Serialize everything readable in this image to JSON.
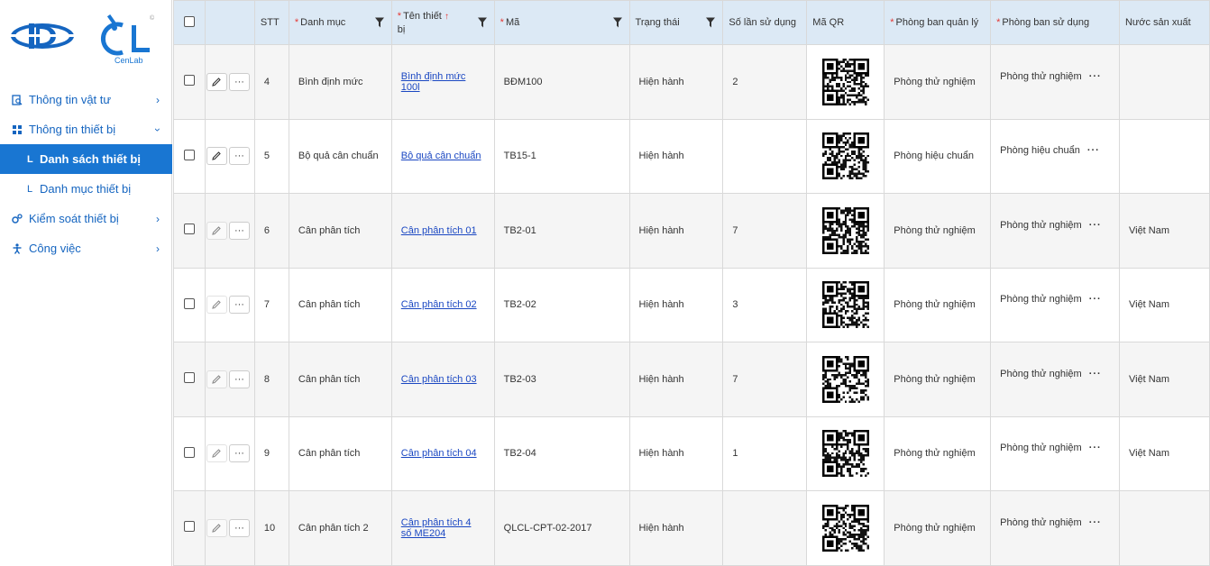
{
  "sidebar": {
    "brand_text": "CenLab",
    "brand_mark": "©",
    "items": [
      {
        "label": "Thông tin vật tư",
        "icon": "document-search-icon"
      },
      {
        "label": "Thông tin thiết bị",
        "icon": "grid-icon"
      },
      {
        "label": "Danh sách thiết bị",
        "prefix": "L",
        "active": true
      },
      {
        "label": "Danh mục thiết bị",
        "prefix": "L"
      },
      {
        "label": "Kiểm soát thiết bị",
        "icon": "gears-icon"
      },
      {
        "label": "Công việc",
        "icon": "person-icon"
      }
    ]
  },
  "table": {
    "headers": {
      "stt": "STT",
      "danh_muc": "Danh mục",
      "ten_thiet_bi_1": "Tên thiết",
      "ten_thiet_bi_2": "bị",
      "ma": "Mã",
      "trang_thai": "Trạng thái",
      "so_lan_su_dung": "Số lần sử dụng",
      "ma_qr": "Mã QR",
      "phong_ban_quan_ly": "Phòng ban quản lý",
      "phong_ban_su_dung": "Phòng ban sử dụng",
      "nuoc_san_xuat": "Nước sản xuất"
    },
    "rows": [
      {
        "stt": "4",
        "danh_muc": "Bình định mức",
        "ten_1": "Bình định mức",
        "ten_2": "100l",
        "ma": "BĐM100",
        "trang_thai": "Hiện hành",
        "so_lan": "2",
        "pb_quan_ly": "Phòng thử nghiệm",
        "pb_su_dung": "Phòng thử nghiệm",
        "nuoc": ""
      },
      {
        "stt": "5",
        "danh_muc": "Bộ quả cân chuẩn",
        "ten_1": "Bộ quả cân chuẩn",
        "ten_2": "",
        "ma": "TB15-1",
        "trang_thai": "Hiện hành",
        "so_lan": "",
        "pb_quan_ly": "Phòng hiệu chuẩn",
        "pb_su_dung": "Phòng hiệu chuẩn",
        "nuoc": ""
      },
      {
        "stt": "6",
        "danh_muc": "Cân phân tích",
        "ten_1": "Cân phân tích 01",
        "ten_2": "",
        "ma": "TB2-01",
        "trang_thai": "Hiện hành",
        "so_lan": "7",
        "pb_quan_ly": "Phòng thử nghiệm",
        "pb_su_dung": "Phòng thử nghiệm",
        "nuoc": "Việt Nam"
      },
      {
        "stt": "7",
        "danh_muc": "Cân phân tích",
        "ten_1": "Cân phân tích 02",
        "ten_2": "",
        "ma": "TB2-02",
        "trang_thai": "Hiện hành",
        "so_lan": "3",
        "pb_quan_ly": "Phòng thử nghiệm",
        "pb_su_dung": "Phòng thử nghiệm",
        "nuoc": "Việt Nam"
      },
      {
        "stt": "8",
        "danh_muc": "Cân phân tích",
        "ten_1": "Cân phân tích 03",
        "ten_2": "",
        "ma": "TB2-03",
        "trang_thai": "Hiện hành",
        "so_lan": "7",
        "pb_quan_ly": "Phòng thử nghiệm",
        "pb_su_dung": "Phòng thử nghiệm",
        "nuoc": "Việt Nam"
      },
      {
        "stt": "9",
        "danh_muc": "Cân phân tích",
        "ten_1": "Cân phân tích 04",
        "ten_2": "",
        "ma": "TB2-04",
        "trang_thai": "Hiện hành",
        "so_lan": "1",
        "pb_quan_ly": "Phòng thử nghiệm",
        "pb_su_dung": "Phòng thử nghiệm",
        "nuoc": "Việt Nam"
      },
      {
        "stt": "10",
        "danh_muc": "Cân phân tích 2",
        "ten_1": "Cân phân tích 4",
        "ten_2": "số ME204",
        "ma": "QLCL-CPT-02-2017",
        "trang_thai": "Hiện hành",
        "so_lan": "",
        "pb_quan_ly": "Phòng thử nghiệm",
        "pb_su_dung": "Phòng thử nghiệm",
        "nuoc": ""
      }
    ],
    "more_label": "···"
  },
  "colors": {
    "accent": "#1976d2",
    "header_bg": "#dce9f5",
    "link": "#1a47c2",
    "required": "#e53935"
  }
}
